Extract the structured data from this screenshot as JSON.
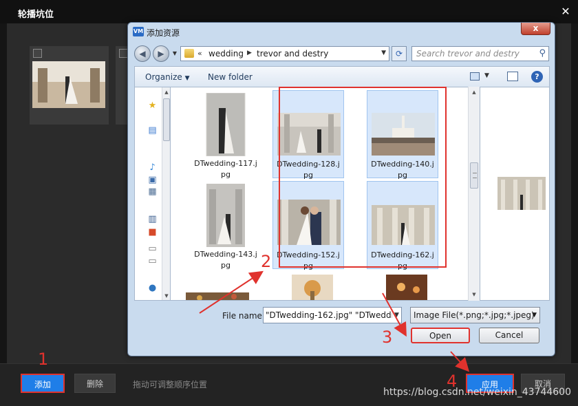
{
  "app": {
    "title": "轮播坑位",
    "close_glyph": "✕",
    "add_label": "添加",
    "delete_label": "删除",
    "hint": "拖动可调整顺序位置",
    "apply_label": "应用",
    "cancel_label": "取消"
  },
  "dialog": {
    "icon_text": "VM",
    "title": "添加资源",
    "close_glyph": "x",
    "address": {
      "chevron": "«",
      "segments": [
        "wedding",
        "trevor and destry"
      ]
    },
    "search_placeholder": "Search trevor and destry",
    "toolbar": {
      "organize": "Organize",
      "new_folder": "New folder"
    },
    "files": [
      {
        "name": "DTwedding-117.j\npg",
        "selected": false
      },
      {
        "name": "DTwedding-128.j\npg",
        "selected": true
      },
      {
        "name": "DTwedding-140.j\npg",
        "selected": true
      },
      {
        "name": "DTwedding-143.j\npg",
        "selected": false
      },
      {
        "name": "DTwedding-152.j\npg",
        "selected": true
      },
      {
        "name": "DTwedding-162.j\npg",
        "selected": true
      }
    ],
    "file_name_label": "File name:",
    "file_name_value": "\"DTwedding-162.jpg\" \"DTwedding",
    "file_type": "Image File(*.png;*.jpg;*.jpeg)",
    "open_label": "Open",
    "cancel_label": "Cancel"
  },
  "annotations": [
    "1",
    "2",
    "3",
    "4"
  ],
  "watermark": "https://blog.csdn.net/weixin_43744600",
  "colors": {
    "accent_blue": "#1f7ee8",
    "annotation_red": "#e0322d",
    "selection_bg": "#d7e7fb"
  }
}
